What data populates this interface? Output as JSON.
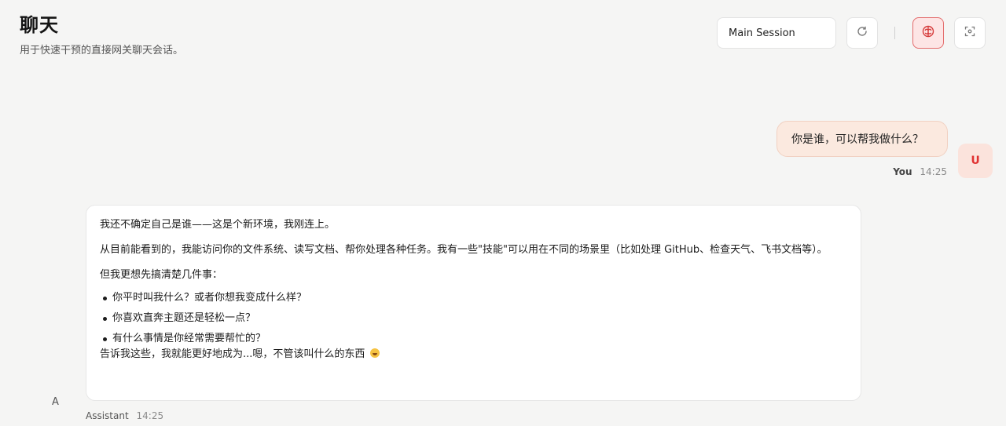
{
  "header": {
    "title": "聊天",
    "subtitle": "用于快速干预的直接网关聊天会话。"
  },
  "toolbar": {
    "session_value": "Main Session",
    "refresh_icon": "refresh-icon",
    "thinking_icon": "brain-icon",
    "focus_icon": "focus-icon",
    "accent_color": "#e36b6b"
  },
  "messages": {
    "user": {
      "text": "你是谁，可以帮我做什么？",
      "sender": "You",
      "time": "14:25",
      "avatar": "U"
    },
    "assistant": {
      "paragraph1": "我还不确定自己是谁——这是个新环境，我刚连上。",
      "paragraph2": "从目前能看到的，我能访问你的文件系统、读写文档、帮你处理各种任务。我有一些\"技能\"可以用在不同的场景里（比如处理 GitHub、检查天气、飞书文档等）。",
      "paragraph3": "但我更想先搞清楚几件事：",
      "bullets": [
        "你平时叫我什么？或者你想我变成什么样？",
        "你喜欢直奔主题还是轻松一点？",
        "有什么事情是你经常需要帮忙的？"
      ],
      "closing": "告诉我这些，我就能更好地成为...嗯，不管该叫什么的东西",
      "emoji": "grinning-face-emoji",
      "sender": "Assistant",
      "time": "14:25",
      "avatar": "A"
    }
  }
}
